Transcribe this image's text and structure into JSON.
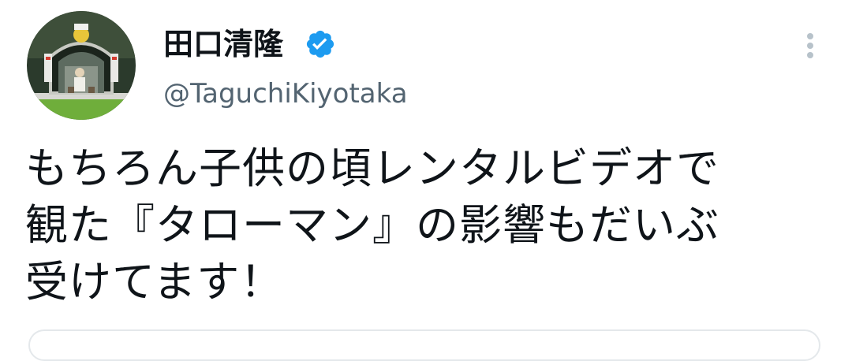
{
  "author": {
    "display_name": "田口清隆",
    "handle": "@TaguchiKiyotaka",
    "verified": true,
    "avatar_icon": "profile-photo-avatar"
  },
  "menu": {
    "icon": "more-vertical-icon"
  },
  "tweet": {
    "lines": [
      "もちろん子供の頃レンタルビデオで",
      "観た『タローマン』の影響もだいぶ",
      "受けてます！"
    ]
  },
  "colors": {
    "text_primary": "#0f1419",
    "text_secondary": "#536471",
    "verified_blue": "#1d9bf0",
    "menu_dots": "#b7c2ca",
    "border": "#e4e8eb"
  }
}
